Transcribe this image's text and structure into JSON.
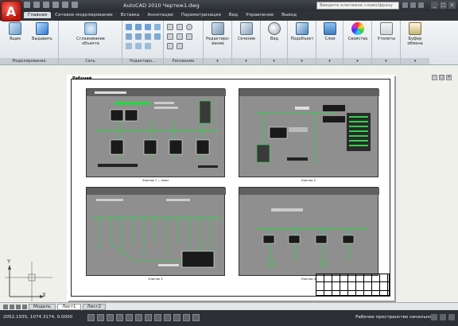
{
  "app": {
    "logo_letter": "A",
    "title": "AutoCAD 2010    Чертеж1.dwg",
    "search_placeholder": "Введите ключевое слово/фразу"
  },
  "tabs": [
    {
      "label": "Главная",
      "active": true
    },
    {
      "label": "Сетевое моделирование"
    },
    {
      "label": "Вставка"
    },
    {
      "label": "Аннотации"
    },
    {
      "label": "Параметризация"
    },
    {
      "label": "Вид"
    },
    {
      "label": "Управление"
    },
    {
      "label": "Вывод"
    }
  ],
  "ribbon": {
    "tools": {
      "box": "Ящик",
      "select": "Выдавить",
      "smooth": "Сглаживание объекта",
      "edit": "Редактиро-вание",
      "section": "Сечение",
      "view": "Вид",
      "subobject": "Подобъект",
      "layers": "Слои",
      "properties": "Свойства",
      "utilities": "Утилиты",
      "clipboard": "Буфер обмена"
    },
    "panels": {
      "modeling": "Моделирование",
      "mesh": "Сеть",
      "solid_edit": "Редактиро...",
      "draw": "Рисование"
    }
  },
  "drawing": {
    "sheet_title": "Рабочий",
    "viewport_captions": [
      "Участок 1 — план",
      "Участок 2",
      "Участок 3",
      "Участок 4"
    ]
  },
  "ucs": {
    "x": "X",
    "y": "Y"
  },
  "layout_tabs": [
    "Модель",
    "Лист1",
    "Лист2"
  ],
  "status": {
    "coords": "2052.1935, 1074.3174, 0.0000",
    "workspace": "Рабочее пространство начально"
  },
  "window_controls": [
    "_",
    "□",
    "×"
  ]
}
